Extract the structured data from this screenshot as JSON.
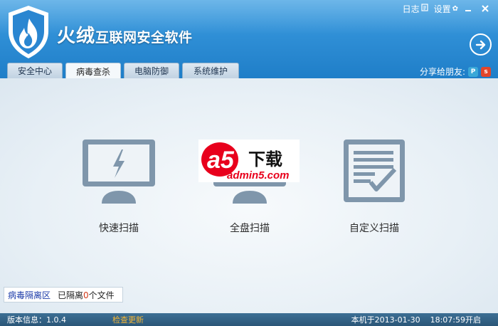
{
  "app": {
    "brand": "火绒",
    "subtitle": "互联网安全软件"
  },
  "topbar": {
    "log_label": "日志",
    "settings_label": "设置"
  },
  "tabs": [
    {
      "label": "安全中心",
      "active": false
    },
    {
      "label": "病毒查杀",
      "active": true
    },
    {
      "label": "电脑防御",
      "active": false
    },
    {
      "label": "系统维护",
      "active": false
    }
  ],
  "share": {
    "label": "分享给朋友:"
  },
  "scan_options": [
    {
      "label": "快速扫描",
      "icon": "monitor-lightning-icon"
    },
    {
      "label": "全盘扫描",
      "icon": "monitor-icon"
    },
    {
      "label": "自定义扫描",
      "icon": "document-check-icon"
    }
  ],
  "watermark": {
    "big": "a5",
    "cn": "下载",
    "url": "admin5.com"
  },
  "quarantine": {
    "link": "病毒隔离区",
    "text_prefix": "已隔离",
    "count": "0",
    "text_suffix": "个文件"
  },
  "status": {
    "version": "版本信息：1.0.4",
    "check_update": "检查更新",
    "boot_time": "本机于2013-01-30    18:07:59开启"
  },
  "colors": {
    "header": "#2f8fd6",
    "statusbar": "#2b5678",
    "update_link": "#f2b536",
    "icon_fill": "#7f96ab",
    "watermark_red": "#e8001c"
  }
}
